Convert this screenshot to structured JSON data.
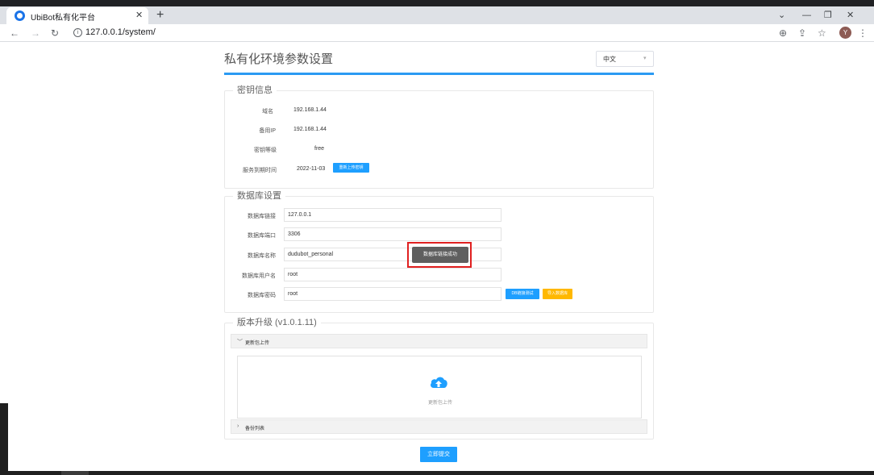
{
  "browser": {
    "tab_title": "UbiBot私有化平台",
    "tab_close": "✕",
    "new_tab": "+",
    "url": "127.0.0.1/system/",
    "profile_initial": "Y",
    "icons": [
      "back-arrow-icon",
      "forward-arrow-icon",
      "reload-icon",
      "site-info-icon",
      "zoom-icon",
      "share-icon",
      "bookmark-star-icon",
      "menu-kebab-icon"
    ]
  },
  "page": {
    "title": "私有化环境参数设置",
    "language": "中文"
  },
  "key_info": {
    "legend": "密钥信息",
    "rows": [
      {
        "label": "域名",
        "value": "192.168.1.44"
      },
      {
        "label": "备用IP",
        "value": "192.168.1.44"
      },
      {
        "label": "密钥等级",
        "value": "free"
      },
      {
        "label": "服务到期时间",
        "value": "2022-11-03"
      }
    ],
    "reupload_button": "重新上传密钥"
  },
  "database": {
    "legend": "数据库设置",
    "fields": [
      {
        "label": "数据库链接",
        "value": "127.0.0.1"
      },
      {
        "label": "数据库端口",
        "value": "3306"
      },
      {
        "label": "数据库名称",
        "value": "dudubot_personal"
      },
      {
        "label": "数据库用户名",
        "value": "root"
      },
      {
        "label": "数据库密码",
        "value": "root"
      }
    ],
    "test_button": "DB链接测试",
    "import_button": "导入数据库",
    "toast": "数据库链接成功"
  },
  "upgrade": {
    "legend": "版本升级 (v1.0.1.11)",
    "upload_section": "更新包上传",
    "upload_text": "更新包上传",
    "backup_section": "备份列表"
  },
  "submit_button": "立即提交",
  "colors": {
    "accent_blue": "#1e9fff",
    "orange": "#ffb800",
    "title_line": "#2b9af3",
    "toast_bg": "#5f5f5f",
    "highlight_red": "#e02020"
  }
}
